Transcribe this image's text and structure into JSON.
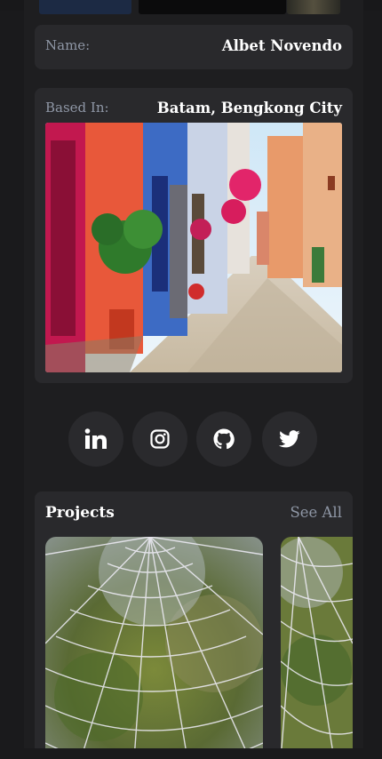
{
  "profile": {
    "name_label": "Name:",
    "name_value": "Albet Novendo",
    "location_label": "Based In:",
    "location_value": "Batam, Bengkong City"
  },
  "social": [
    {
      "icon": "linkedin-icon",
      "label": "in"
    },
    {
      "icon": "instagram-icon"
    },
    {
      "icon": "github-icon"
    },
    {
      "icon": "twitter-icon"
    }
  ],
  "projects": {
    "title": "Projects",
    "see_all_label": "See All"
  },
  "colors": {
    "background": "#1a1a1c",
    "card": "#29292c",
    "label": "#8f97a6",
    "text": "#ffffff"
  }
}
